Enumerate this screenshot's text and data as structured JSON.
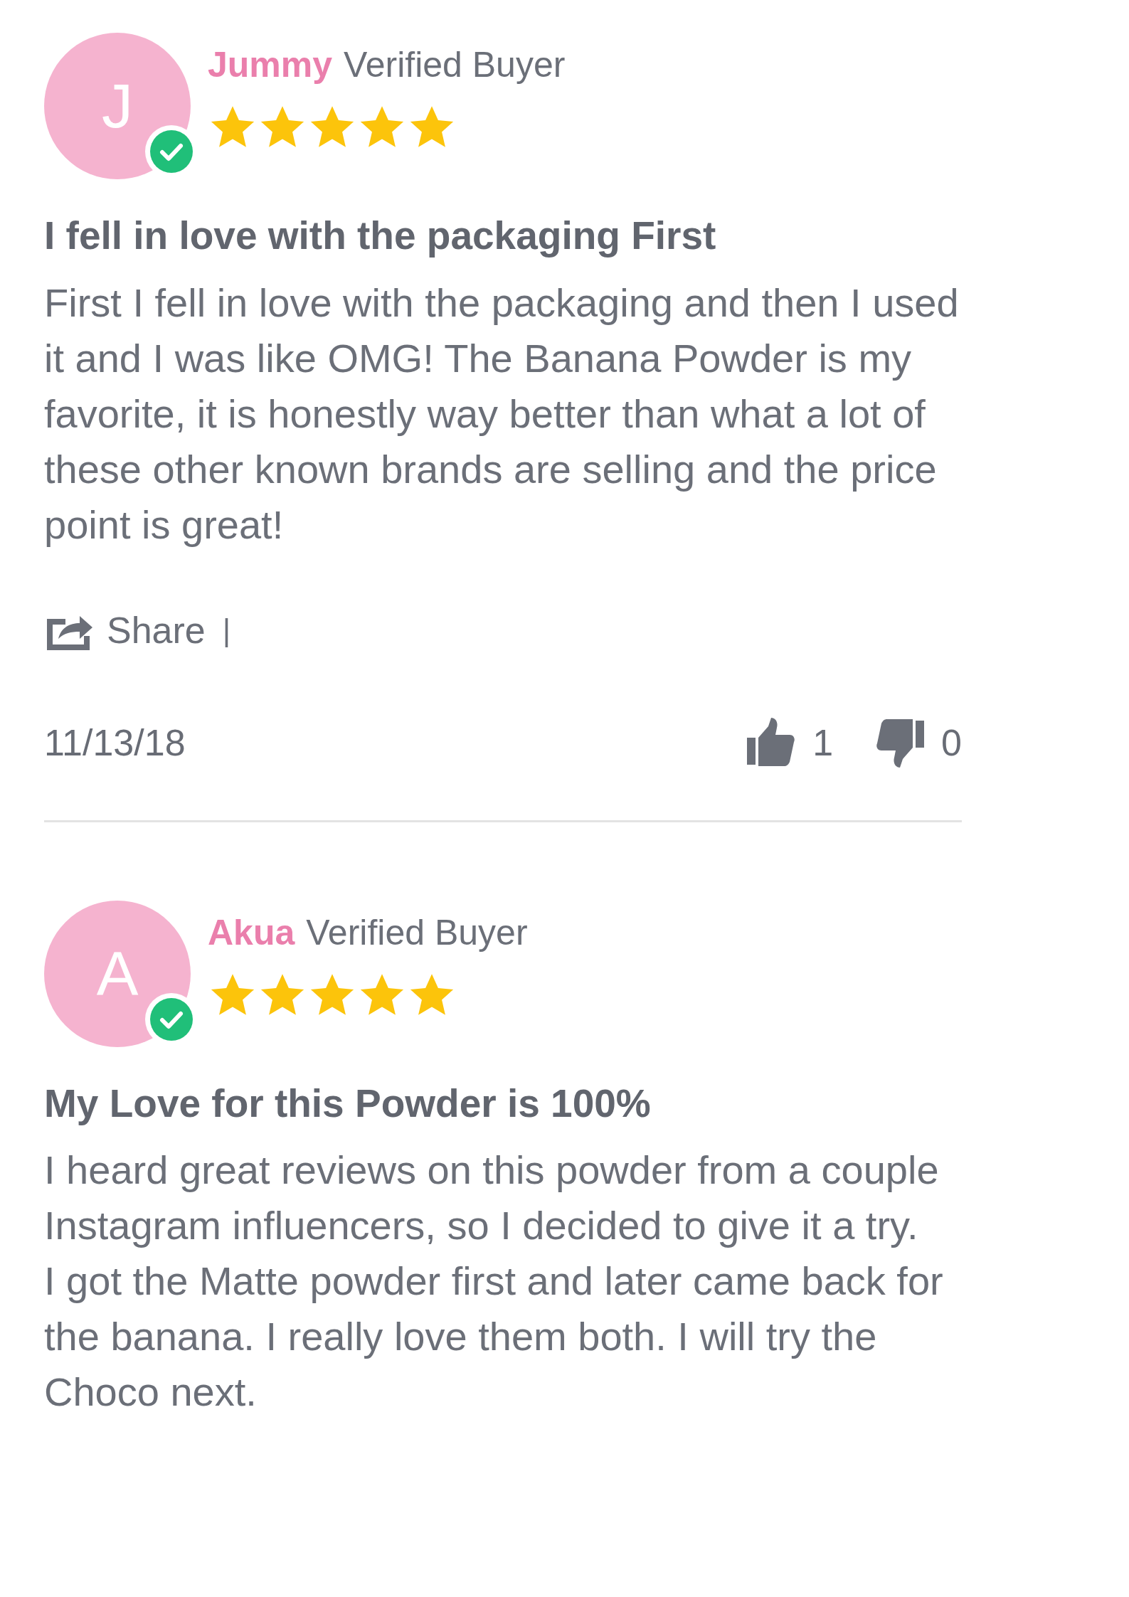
{
  "reviews": [
    {
      "avatar_letter": "J",
      "name": "Jummy",
      "badge": "Verified Buyer",
      "verified": true,
      "stars": 5,
      "title": "I fell in love with the packaging First",
      "body": "First I fell in love with the packaging and then I used it and I was like OMG! The Banana Powder is my favorite, it is honestly way better than what a lot of these other known brands are selling and the price point is great!",
      "share": "Share",
      "separator": "|",
      "date": "11/13/18",
      "upvotes": "1",
      "downvotes": "0"
    },
    {
      "avatar_letter": "A",
      "name": "Akua",
      "badge": "Verified Buyer",
      "verified": true,
      "stars": 5,
      "title": "My Love for this Powder is 100%",
      "body": "I heard great reviews on this powder from a couple Instagram influencers, so I decided to give it a try.\nI got the Matte powder first and later came back for the banana. I really love them both. I will try the Choco next."
    }
  ]
}
